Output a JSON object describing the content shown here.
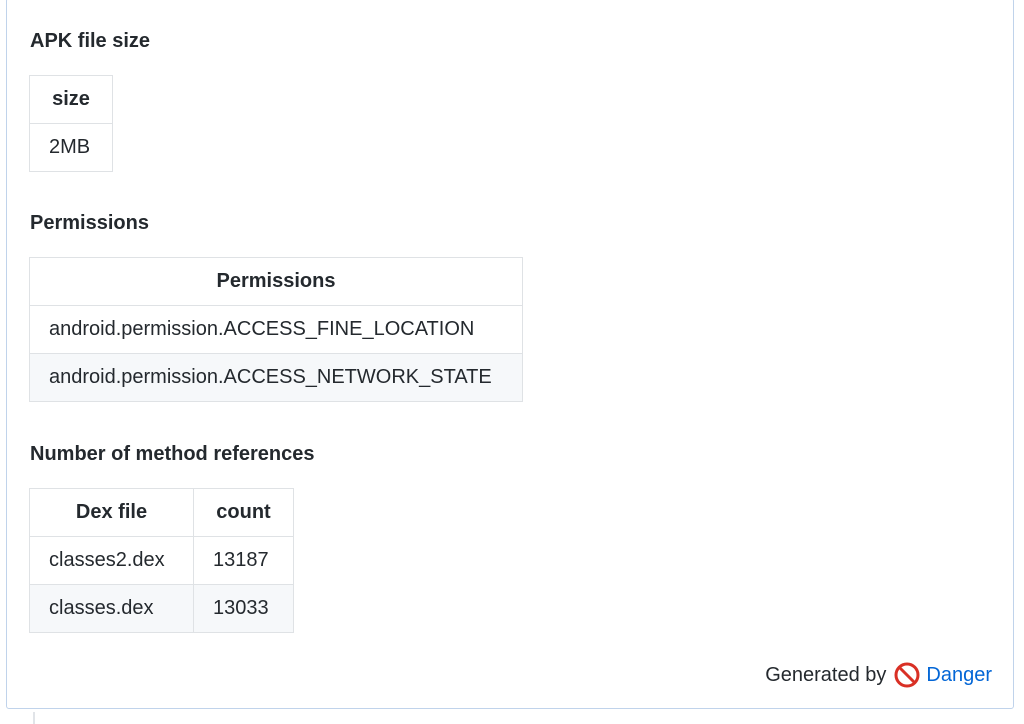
{
  "apk_size": {
    "title": "APK file size",
    "header": "size",
    "rows": [
      "2MB"
    ]
  },
  "permissions": {
    "title": "Permissions",
    "header": "Permissions",
    "rows": [
      "android.permission.ACCESS_FINE_LOCATION",
      "android.permission.ACCESS_NETWORK_STATE"
    ]
  },
  "methods": {
    "title": "Number of method references",
    "headers": [
      "Dex file",
      "count"
    ],
    "rows": [
      [
        "classes2.dex",
        "13187"
      ],
      [
        "classes.dex",
        "13033"
      ]
    ]
  },
  "footer": {
    "prefix": "Generated by",
    "icon": "no-entry-icon",
    "link_label": "Danger"
  },
  "colors": {
    "link": "#0366d6",
    "border": "#dfe2e5",
    "stripe": "#f6f8fa",
    "box_border": "#c0d3eb"
  }
}
